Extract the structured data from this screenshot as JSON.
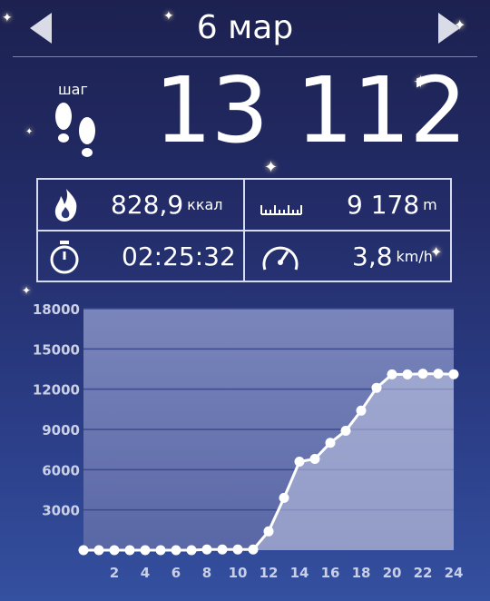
{
  "header": {
    "date": "6 мар"
  },
  "summary": {
    "steps_label": "шаг",
    "steps_value": "13 112"
  },
  "stats": {
    "calories_value": "828,9",
    "calories_unit": "ккал",
    "distance_value": "9 178",
    "distance_unit": "m",
    "time_value": "02:25:32",
    "speed_value": "3,8",
    "speed_unit": "km/h"
  },
  "icons": {
    "prev": "triangle-left-icon",
    "next": "triangle-right-icon",
    "steps": "footprints-icon",
    "calories": "flame-icon",
    "distance": "ruler-icon",
    "time": "stopwatch-icon",
    "speed": "speedometer-icon"
  },
  "colors": {
    "accent": "#d7dbee",
    "chart_bg_top": "#7a86bb",
    "chart_bg_bottom": "#5967a6",
    "line": "#ffffff"
  },
  "chart_data": {
    "type": "area",
    "x": [
      0,
      1,
      2,
      3,
      4,
      5,
      6,
      7,
      8,
      9,
      10,
      11,
      12,
      13,
      14,
      15,
      16,
      17,
      18,
      19,
      20,
      21,
      22,
      23,
      24
    ],
    "values": [
      0,
      0,
      0,
      0,
      0,
      0,
      0,
      0,
      50,
      50,
      50,
      50,
      1400,
      3900,
      6600,
      6800,
      8000,
      8900,
      10400,
      12100,
      13100,
      13100,
      13150,
      13150,
      13112
    ],
    "y_ticks": [
      "18000",
      "15000",
      "12000",
      "9000",
      "6000",
      "3000"
    ],
    "x_ticks": [
      "2",
      "4",
      "6",
      "8",
      "10",
      "12",
      "14",
      "16",
      "18",
      "20",
      "22",
      "24"
    ],
    "ylim": [
      0,
      18000
    ],
    "xlim": [
      0,
      24
    ],
    "grid": true
  }
}
